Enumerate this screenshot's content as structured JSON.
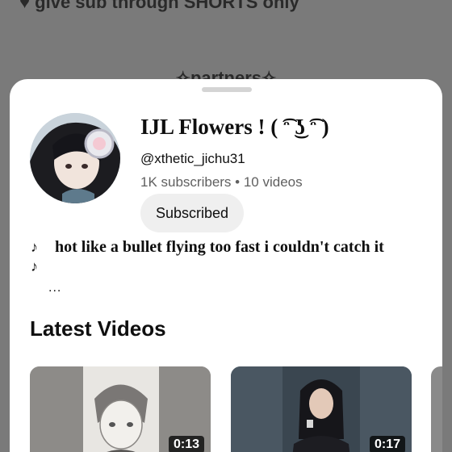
{
  "background": {
    "top_text": "♥ give sub  through SHORTS only",
    "partners_text": "✧partners✧"
  },
  "channel": {
    "name": "IJL Flowers ! ( ͡ᵔ ͜ʖ ͡ᵔ )",
    "handle": "@xthetic_jichu31",
    "meta": "1K subscribers • 10 videos",
    "subscribe_label": "Subscribed",
    "description_line1": "hot like a bullet flying too fast i couldn't catch it",
    "note_glyph": "♪",
    "more": "..."
  },
  "section": {
    "title": "Latest Videos"
  },
  "videos": [
    {
      "duration": "0:13"
    },
    {
      "duration": "0:17"
    }
  ],
  "colors": {
    "sheet": "#ffffff",
    "overlay": "#7a7a7a",
    "button": "#efefef"
  }
}
